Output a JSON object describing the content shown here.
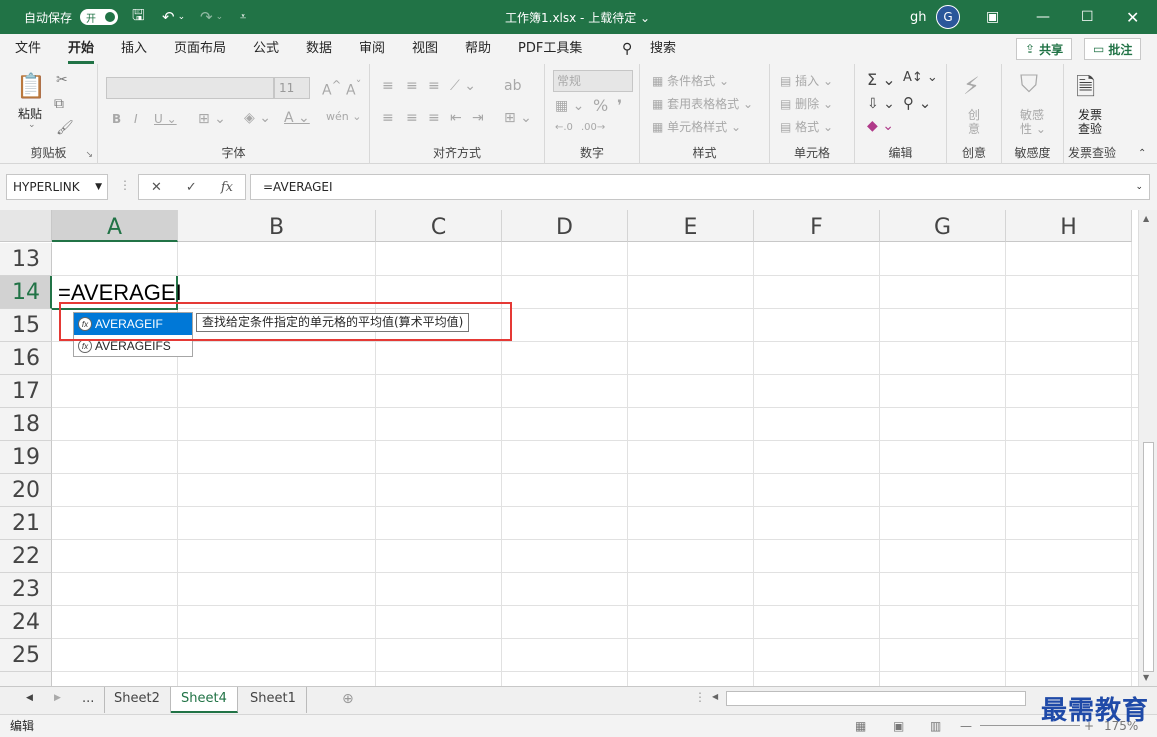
{
  "titlebar": {
    "autosave_label": "自动保存",
    "autosave_state": "开",
    "title": "工作簿1.xlsx - 上载待定 ⌄",
    "user": "gh",
    "avatar": "G"
  },
  "menu": {
    "items": [
      "文件",
      "开始",
      "插入",
      "页面布局",
      "公式",
      "数据",
      "审阅",
      "视图",
      "帮助",
      "PDF工具集"
    ],
    "search": "搜索",
    "share": "共享",
    "comment": "批注"
  },
  "ribbon": {
    "groups": [
      {
        "label": "剪贴板",
        "paste": "粘贴"
      },
      {
        "label": "字体",
        "font_size": "11"
      },
      {
        "label": "对齐方式"
      },
      {
        "label": "数字",
        "format": "常规"
      },
      {
        "label": "样式",
        "items": [
          "条件格式 ⌄",
          "套用表格格式 ⌄",
          "单元格样式 ⌄"
        ]
      },
      {
        "label": "单元格",
        "items": [
          "插入 ⌄",
          "删除 ⌄",
          "格式 ⌄"
        ]
      },
      {
        "label": "编辑"
      },
      {
        "label": "创意",
        "btn1": "创",
        "btn2": "意"
      },
      {
        "label": "敏感度",
        "btn1": "敏感",
        "btn2": "性 ⌄"
      },
      {
        "label": "发票查验",
        "btn1": "发票",
        "btn2": "查验"
      }
    ]
  },
  "formula_bar": {
    "name_box": "HYPERLINK",
    "formula": "=AVERAGEI"
  },
  "grid": {
    "columns": [
      "A",
      "B",
      "C",
      "D",
      "E",
      "F",
      "G",
      "H"
    ],
    "rows": [
      "13",
      "14",
      "15",
      "16",
      "17",
      "18",
      "19",
      "20",
      "21",
      "22",
      "23",
      "24",
      "25"
    ],
    "active_cell_text": "=AVERAGEI"
  },
  "autocomplete": {
    "items": [
      "AVERAGEIF",
      "AVERAGEIFS"
    ],
    "tooltip": "查找给定条件指定的单元格的平均值(算术平均值)"
  },
  "sheets": {
    "tabs": [
      "Sheet2",
      "Sheet4",
      "Sheet1"
    ],
    "active": "Sheet4",
    "ellipsis": "..."
  },
  "status": {
    "mode": "编辑",
    "zoom": "175%"
  },
  "watermark": "最需教育"
}
